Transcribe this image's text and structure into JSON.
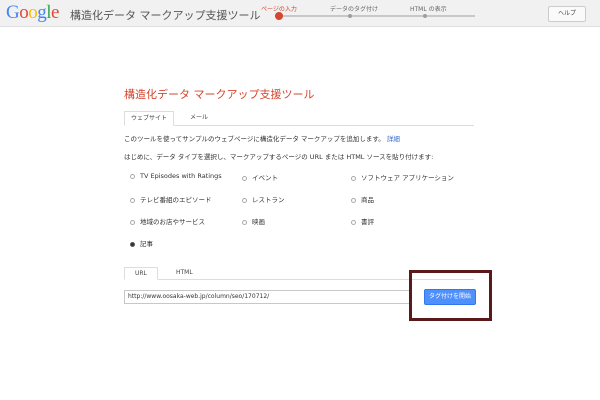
{
  "header": {
    "logo": "Google",
    "title": "構造化データ マークアップ支援ツール",
    "steps": [
      "ページの入力",
      "データのタグ付け",
      "HTML の表示"
    ],
    "help_label": "ヘルプ"
  },
  "main": {
    "title": "構造化データ マークアップ支援ツール",
    "tabs": [
      {
        "label": "ウェブサイト",
        "active": true
      },
      {
        "label": "メール",
        "active": false
      }
    ],
    "description": "このツールを使ってサンプルのウェブページに構造化データ マークアップを追加します。",
    "details_link": "詳細",
    "instruction": "はじめに、データ タイプを選択し、マークアップするページの URL または HTML ソースを貼り付けます:",
    "data_types": [
      {
        "label": "TV Episodes with Ratings",
        "checked": false
      },
      {
        "label": "イベント",
        "checked": false
      },
      {
        "label": "ソフトウェア アプリケーション",
        "checked": false
      },
      {
        "label": "テレビ番組のエピソード",
        "checked": false
      },
      {
        "label": "レストラン",
        "checked": false
      },
      {
        "label": "商品",
        "checked": false
      },
      {
        "label": "地域のお店やサービス",
        "checked": false
      },
      {
        "label": "映画",
        "checked": false
      },
      {
        "label": "書評",
        "checked": false
      },
      {
        "label": "記事",
        "checked": true
      }
    ],
    "source_tabs": [
      {
        "label": "URL",
        "active": true
      },
      {
        "label": "HTML",
        "active": false
      }
    ],
    "url_value": "http://www.oosaka-web.jp/column/seo/170712/",
    "start_button": "タグ付けを開始"
  },
  "colors": {
    "accent_red": "#d3462f",
    "button_blue": "#4d90fe",
    "highlight": "#5a1a1c"
  }
}
